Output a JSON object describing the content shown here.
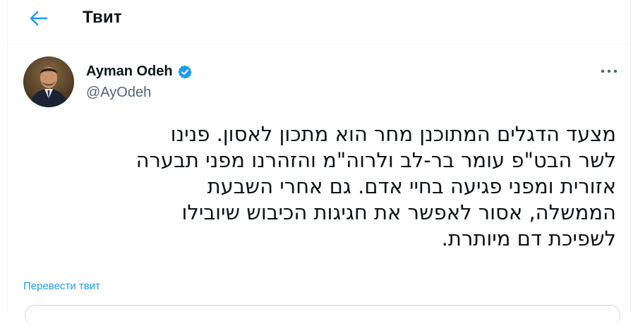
{
  "header": {
    "title": "Твит",
    "back_icon": "arrow-left-icon"
  },
  "tweet": {
    "author": {
      "display_name": "Ayman Odeh",
      "handle": "@AyOdeh",
      "verified": true,
      "verified_icon": "verified-badge-icon"
    },
    "more_icon": "more-options-icon",
    "text": "מצעד הדגלים המתוכנן מחר הוא מתכון לאסון. פנינו\nלשר הבט\"פ עומר בר-לב ולרוה\"מ והזהרנו מפני תבערה\nאזורית ומפני פגיעה בחיי אדם. גם אחרי השבעת\nהממשלה, אסור לאפשר את חגיגות הכיבוש שיובילו\nלשפיכת דם מיותרת.",
    "translate_label": "Перевести твит"
  },
  "colors": {
    "accent": "#1d9bf0",
    "text_primary": "#0f1419",
    "text_secondary": "#536471",
    "border": "#eff3f4"
  }
}
